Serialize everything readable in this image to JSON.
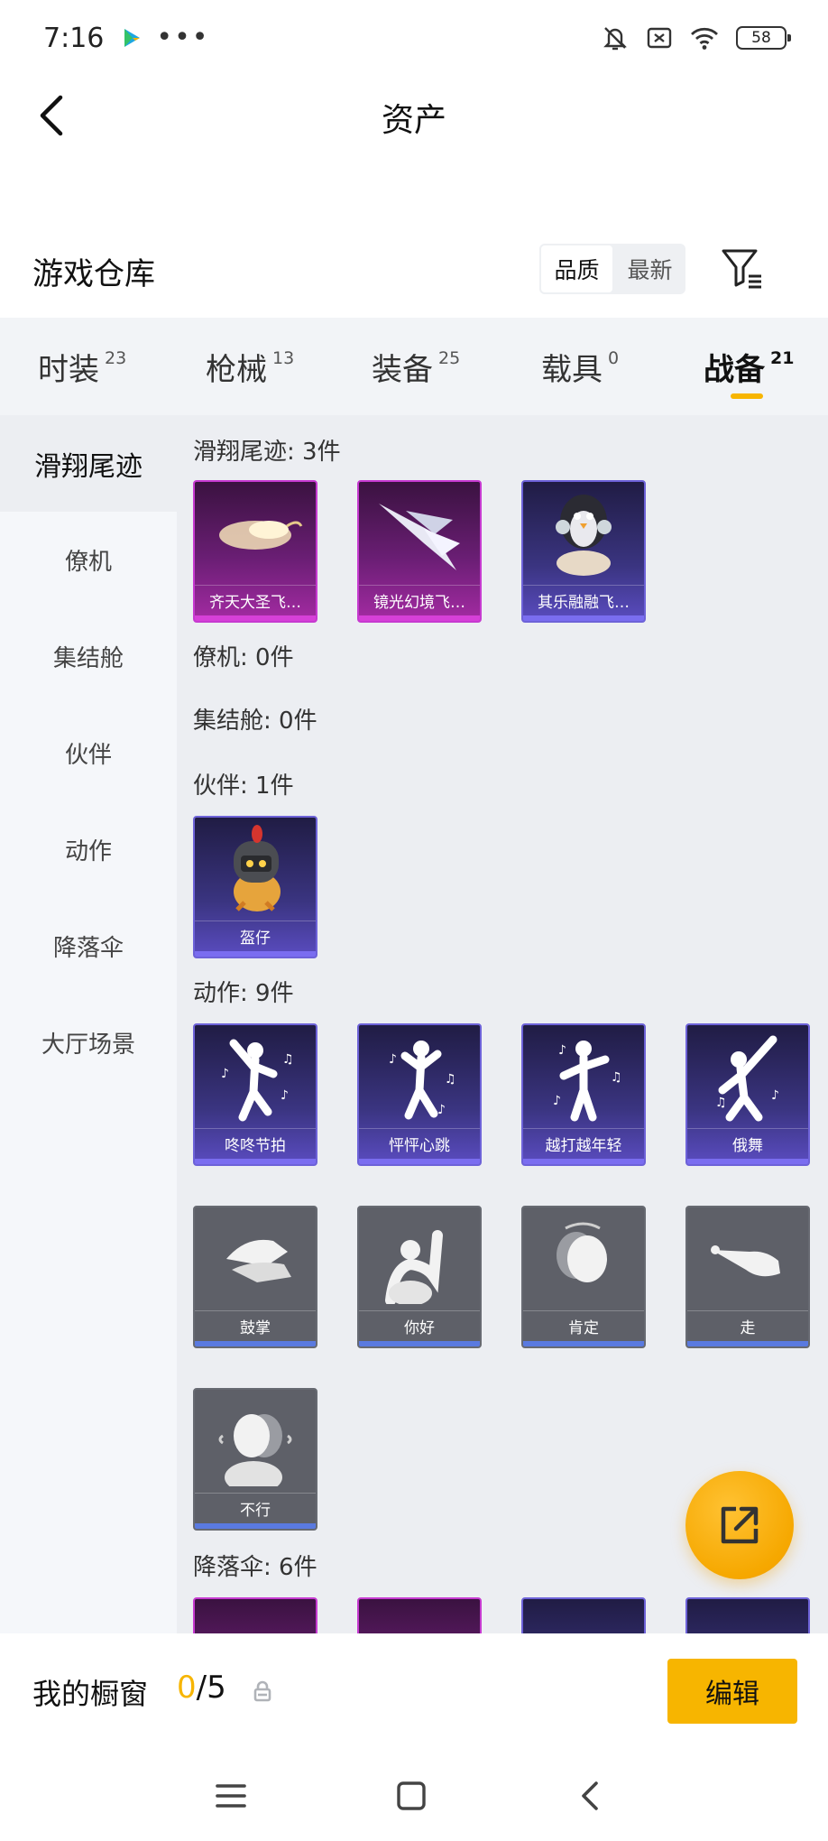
{
  "status": {
    "time": "7:16",
    "battery": "58"
  },
  "header": {
    "title": "资产"
  },
  "warehouse": {
    "title": "游戏仓库",
    "sort_options": [
      "品质",
      "最新"
    ]
  },
  "tabs": [
    {
      "label": "时装",
      "count": "23"
    },
    {
      "label": "枪械",
      "count": "13"
    },
    {
      "label": "装备",
      "count": "25"
    },
    {
      "label": "载具",
      "count": "0"
    },
    {
      "label": "战备",
      "count": "21"
    }
  ],
  "categories": [
    "滑翔尾迹",
    "僚机",
    "集结舱",
    "伙伴",
    "动作",
    "降落伞",
    "大厅场景"
  ],
  "sections": {
    "trail": {
      "title": "滑翔尾迹: 3件",
      "items": [
        "齐天大圣飞…",
        "镜光幻境飞…",
        "其乐融融飞…"
      ]
    },
    "wingman": {
      "title": "僚机: 0件"
    },
    "pod": {
      "title": "集结舱: 0件"
    },
    "partner": {
      "title": "伙伴: 1件",
      "items": [
        "盔仔"
      ]
    },
    "emote": {
      "title": "动作: 9件",
      "items": [
        "咚咚节拍",
        "怦怦心跳",
        "越打越年轻",
        "俄舞",
        "鼓掌",
        "你好",
        "肯定",
        "走",
        "不行"
      ]
    },
    "parachute": {
      "title": "降落伞: 6件"
    }
  },
  "showcase": {
    "label": "我的橱窗",
    "current": "0",
    "total": "/5",
    "edit_label": "编辑"
  },
  "colors": {
    "accent": "#f7b500",
    "pink_quality": "#c63ad0",
    "purple_quality": "#6d62d8",
    "gray_quality": "#5e6068"
  }
}
